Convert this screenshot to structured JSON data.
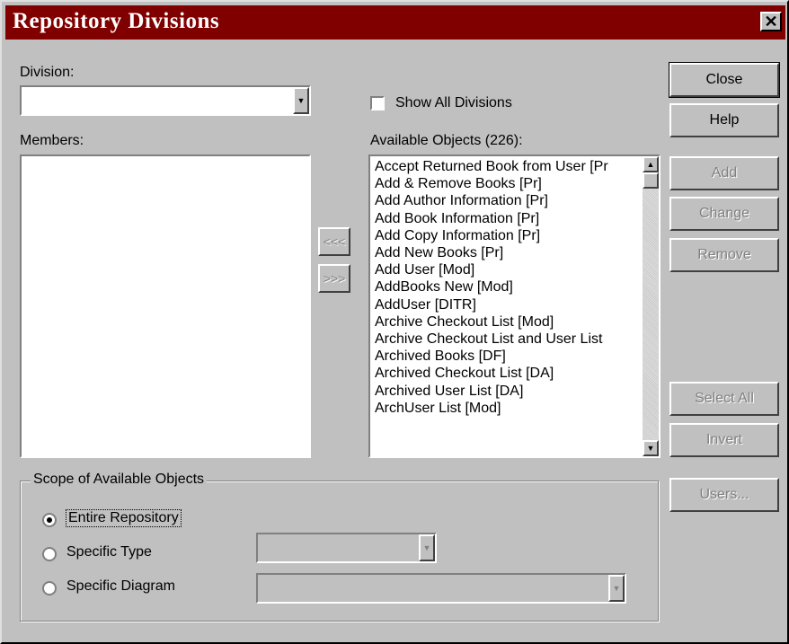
{
  "window": {
    "title": "Repository Divisions",
    "close_glyph": "✕"
  },
  "division": {
    "label": "Division:",
    "value": ""
  },
  "show_all": {
    "label": "Show All Divisions",
    "checked": false
  },
  "members": {
    "label": "Members:",
    "items": []
  },
  "transfer": {
    "to_members": "<<<",
    "to_available": ">>>"
  },
  "available": {
    "label": "Available Objects (226):",
    "items": [
      "Accept Returned Book from User [Pr",
      "Add & Remove Books [Pr]",
      "Add Author Information [Pr]",
      "Add Book Information [Pr]",
      "Add Copy Information [Pr]",
      "Add New Books [Pr]",
      "Add User [Mod]",
      "AddBooks New [Mod]",
      "AddUser [DITR]",
      "Archive Checkout List [Mod]",
      "Archive Checkout List and User List",
      "Archived Books [DF]",
      "Archived Checkout List [DA]",
      "Archived User List [DA]",
      "ArchUser List [Mod]"
    ]
  },
  "buttons": {
    "close": "Close",
    "help": "Help",
    "add": "Add",
    "change": "Change",
    "remove": "Remove",
    "select_all": "Select All",
    "invert": "Invert",
    "users": "Users..."
  },
  "scope": {
    "title": "Scope of Available Objects",
    "entire": "Entire Repository",
    "type": "Specific Type",
    "diagram": "Specific Diagram",
    "selected": "entire"
  },
  "colors": {
    "titlebar": "#800000",
    "face": "#c0c0c0"
  }
}
